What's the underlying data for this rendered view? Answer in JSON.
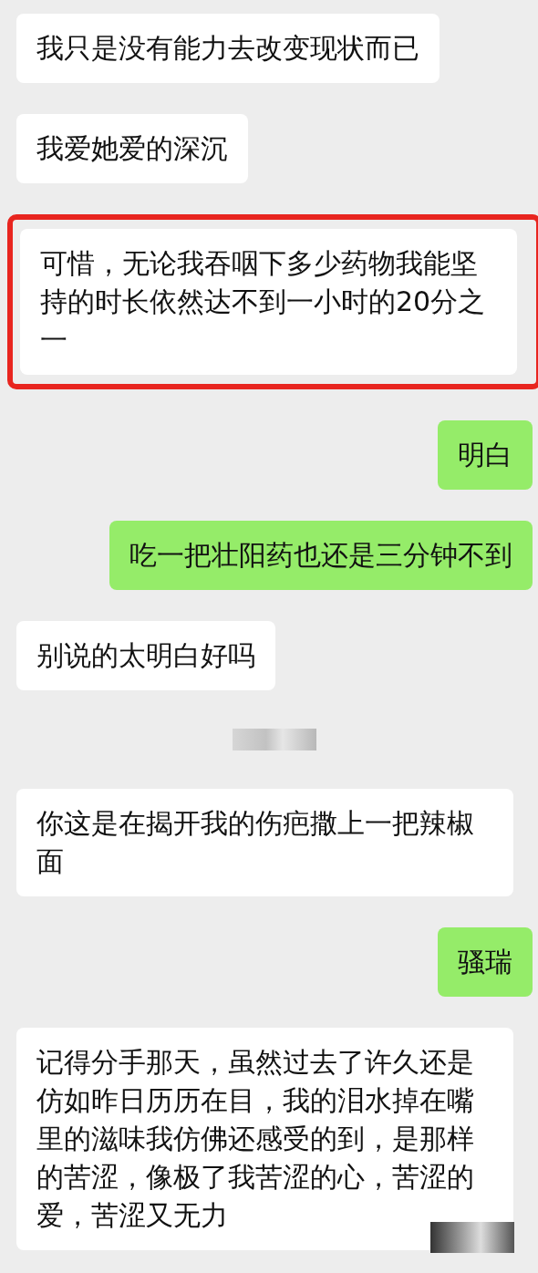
{
  "messages": [
    {
      "kind": "incoming",
      "text": "我只是没有能力去改变现状而已",
      "highlighted": false
    },
    {
      "kind": "incoming",
      "text": "我爱她爱的深沉",
      "highlighted": false
    },
    {
      "kind": "incoming",
      "text": "可惜，无论我吞咽下多少药物我能坚持的时长依然达不到一小时的20分之一",
      "highlighted": true
    },
    {
      "kind": "outgoing",
      "text": "明白",
      "highlighted": false
    },
    {
      "kind": "outgoing",
      "text": "吃一把壮阳药也还是三分钟不到",
      "highlighted": false
    },
    {
      "kind": "incoming",
      "text": "别说的太明白好吗",
      "highlighted": false
    },
    {
      "kind": "blurred"
    },
    {
      "kind": "incoming",
      "text": "你这是在揭开我的伤疤撒上一把辣椒面",
      "highlighted": false
    },
    {
      "kind": "outgoing",
      "text": "骚瑞",
      "highlighted": false
    },
    {
      "kind": "incoming",
      "text": "记得分手那天，虽然过去了许久还是仿如昨日历历在目，我的泪水掉在嘴里的滋味我仿佛还感受的到，是那样的苦涩，像极了我苦涩的心，苦涩的爱，苦涩又无力",
      "highlighted": false
    }
  ]
}
